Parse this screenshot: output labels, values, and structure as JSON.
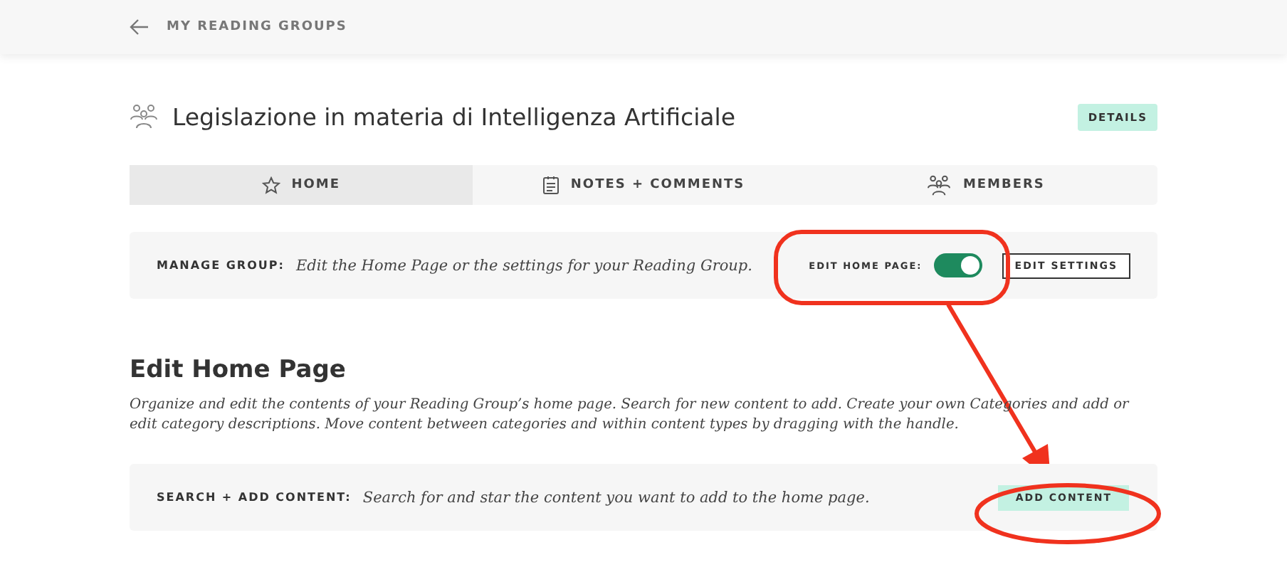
{
  "header": {
    "back_label": "MY READING GROUPS"
  },
  "group": {
    "title": "Legislazione in materia di Intelligenza Artificiale",
    "details_button": "DETAILS"
  },
  "tabs": [
    {
      "kind": "star",
      "label": "HOME",
      "selected": true
    },
    {
      "kind": "notes",
      "label": "NOTES + COMMENTS",
      "selected": false
    },
    {
      "kind": "members",
      "label": "MEMBERS",
      "selected": false
    }
  ],
  "manage": {
    "label": "MANAGE GROUP:",
    "text": "Edit the Home Page or the settings for your Reading Group.",
    "toggle_label": "EDIT HOME PAGE:",
    "toggle_on": true,
    "settings_button": "EDIT SETTINGS"
  },
  "edit": {
    "heading": "Edit Home Page",
    "description": "Organize and edit the contents of your Reading Group’s home page. Search for new content to add. Create your own Categories and add or edit category descriptions. Move content between categories and within content types by dragging with the handle.",
    "search_label": "SEARCH + ADD CONTENT:",
    "search_text": "Search for and star the content you want to add to the home page.",
    "add_button": "ADD CONTENT"
  }
}
